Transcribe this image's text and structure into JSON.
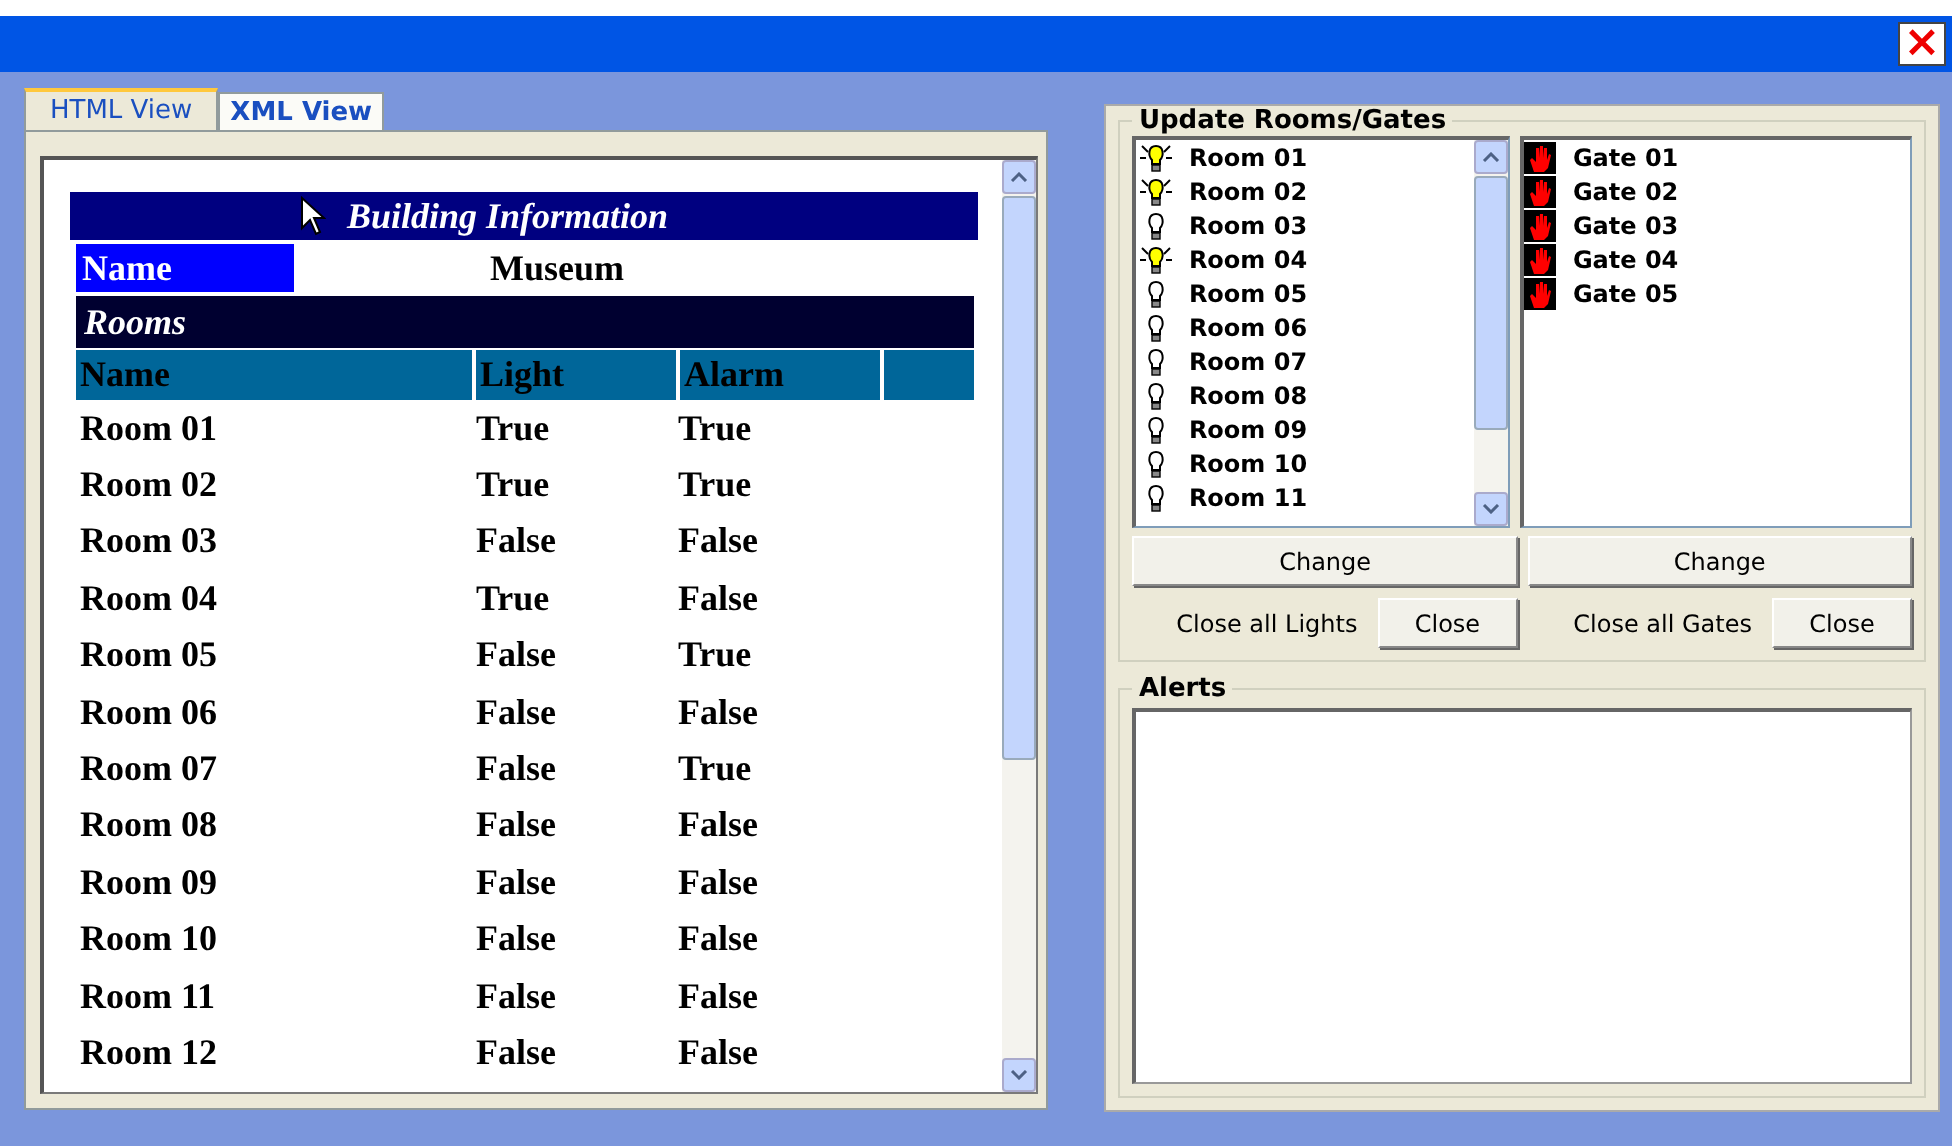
{
  "window": {
    "close_label": "×"
  },
  "tabs": [
    {
      "label": "HTML View",
      "selected": true
    },
    {
      "label": "XML View",
      "selected": false
    }
  ],
  "building": {
    "title": "Building Information",
    "name_label": "Name",
    "name_value": "Museum",
    "rooms_title": "Rooms",
    "columns": [
      "Name",
      "Light",
      "Alarm"
    ],
    "rows": [
      [
        "Room 01",
        "True",
        "True"
      ],
      [
        "Room 02",
        "True",
        "True"
      ],
      [
        "Room 03",
        "False",
        "False"
      ],
      [
        "Room 04",
        "True",
        "False"
      ],
      [
        "Room 05",
        "False",
        "True"
      ],
      [
        "Room 06",
        "False",
        "False"
      ],
      [
        "Room 07",
        "False",
        "True"
      ],
      [
        "Room 08",
        "False",
        "False"
      ],
      [
        "Room 09",
        "False",
        "False"
      ],
      [
        "Room 10",
        "False",
        "False"
      ],
      [
        "Room 11",
        "False",
        "False"
      ],
      [
        "Room 12",
        "False",
        "False"
      ]
    ]
  },
  "update": {
    "title": "Update Rooms/Gates",
    "rooms": [
      {
        "label": "Room 01",
        "lit": true
      },
      {
        "label": "Room 02",
        "lit": true
      },
      {
        "label": "Room 03",
        "lit": false
      },
      {
        "label": "Room 04",
        "lit": true
      },
      {
        "label": "Room 05",
        "lit": false
      },
      {
        "label": "Room 06",
        "lit": false
      },
      {
        "label": "Room 07",
        "lit": false
      },
      {
        "label": "Room 08",
        "lit": false
      },
      {
        "label": "Room 09",
        "lit": false
      },
      {
        "label": "Room 10",
        "lit": false
      },
      {
        "label": "Room 11",
        "lit": false
      }
    ],
    "gates": [
      "Gate 01",
      "Gate 02",
      "Gate 03",
      "Gate 04",
      "Gate 05"
    ],
    "change_rooms": "Change",
    "change_gates": "Change",
    "close_lights_label": "Close all Lights",
    "close_lights_button": "Close",
    "close_gates_label": "Close all Gates",
    "close_gates_button": "Close"
  },
  "alerts": {
    "title": "Alerts"
  }
}
